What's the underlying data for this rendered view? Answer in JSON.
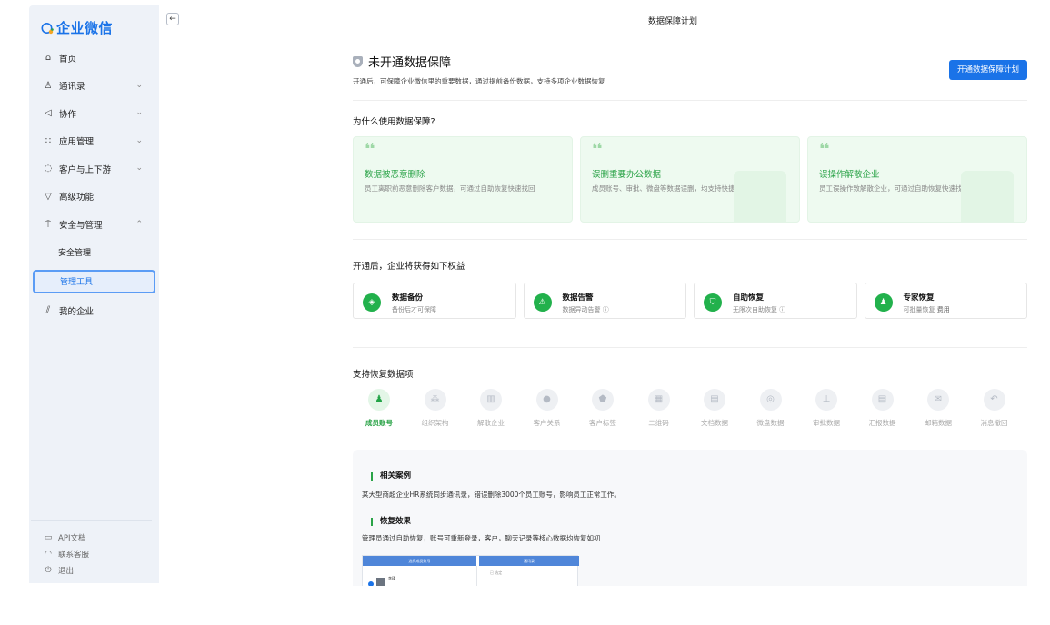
{
  "app": {
    "logo_text": "企业微信",
    "page_title": "数据保障计划",
    "back_icon": "←"
  },
  "sidebar": {
    "items": [
      {
        "label": "首页",
        "icon": "home-icon",
        "glyph": "⌂",
        "chevron": ""
      },
      {
        "label": "通讯录",
        "icon": "contacts-icon",
        "glyph": "♙",
        "chevron": "⌄"
      },
      {
        "label": "协作",
        "icon": "collab-icon",
        "glyph": "◁",
        "chevron": "⌄"
      },
      {
        "label": "应用管理",
        "icon": "apps-icon",
        "glyph": "∷",
        "chevron": "⌄"
      },
      {
        "label": "客户与上下游",
        "icon": "customer-icon",
        "glyph": "◌",
        "chevron": "⌄"
      },
      {
        "label": "高级功能",
        "icon": "advanced-icon",
        "glyph": "▽",
        "chevron": ""
      },
      {
        "label": "安全与管理",
        "icon": "security-icon",
        "glyph": "⍑",
        "chevron": "⌃"
      }
    ],
    "sub_items": [
      {
        "label": "安全管理"
      },
      {
        "label": "管理工具"
      }
    ],
    "my_company": {
      "label": "我的企业",
      "glyph": "⫽"
    },
    "bottom": [
      {
        "label": "API文档",
        "glyph": "▭"
      },
      {
        "label": "联系客服",
        "glyph": "◠"
      },
      {
        "label": "退出",
        "glyph": "⏻"
      }
    ]
  },
  "status": {
    "title": "未开通数据保障",
    "desc": "开通后，可保障企业微信里的重要数据，通过提前备份数据，支持多项企业数据恢复",
    "open_button": "开通数据保障计划"
  },
  "why": {
    "title": "为什么使用数据保障?",
    "quote": "❛❛",
    "cards": [
      {
        "title": "数据被恶意删除",
        "desc": "员工离职前恶意删除客户数据，可通过自助恢复快速找回"
      },
      {
        "title": "误删重要办公数据",
        "desc": "成员账号、审批、微盘等数据误删，均支持快捷找回"
      },
      {
        "title": "误操作解散企业",
        "desc": "员工误操作致解散企业，可通过自助恢复快速找回企业"
      }
    ]
  },
  "benefits": {
    "title": "开通后，企业将获得如下权益",
    "items": [
      {
        "name": "数据备份",
        "desc": "备份后才可保障",
        "glyph": "◈",
        "extra": ""
      },
      {
        "name": "数据告警",
        "desc": "数据异动告警 ⓘ",
        "glyph": "⚠",
        "extra": ""
      },
      {
        "name": "自助恢复",
        "desc": "无限次自助恢复 ⓘ",
        "glyph": "⛉",
        "extra": ""
      },
      {
        "name": "专家恢复",
        "desc": "可批量恢复 ",
        "glyph": "♟",
        "extra": "费用"
      }
    ]
  },
  "recover": {
    "title": "支持恢复数据项",
    "items": [
      {
        "label": "成员账号",
        "glyph": "♟",
        "active": true
      },
      {
        "label": "组织架构",
        "glyph": "⁂",
        "active": false
      },
      {
        "label": "解散企业",
        "glyph": "▥",
        "active": false
      },
      {
        "label": "客户关系",
        "glyph": "●",
        "active": false
      },
      {
        "label": "客户标签",
        "glyph": "⬟",
        "active": false
      },
      {
        "label": "二维码",
        "glyph": "▦",
        "active": false
      },
      {
        "label": "文档数据",
        "glyph": "▤",
        "active": false
      },
      {
        "label": "微盘数据",
        "glyph": "◎",
        "active": false
      },
      {
        "label": "审批数据",
        "glyph": "⊥",
        "active": false
      },
      {
        "label": "汇报数据",
        "glyph": "▤",
        "active": false
      },
      {
        "label": "邮箱数据",
        "glyph": "✉",
        "active": false
      },
      {
        "label": "消息撤回",
        "glyph": "↶",
        "active": false
      }
    ]
  },
  "detail": {
    "case_title": "相关案例",
    "case_text": "某大型商超企业HR系统同步通讯录，错误删除3000个员工账号，影响员工正常工作。",
    "effect_title": "恢复效果",
    "effect_text": "管理员通过自助恢复，账号可重新登录，客户，聊天记录等核心数据均恢复如初",
    "mock_left": "选择成员账号",
    "mock_right": "通讯录",
    "mock_name": "李瑾",
    "mock_sub": "已 选定"
  },
  "colors": {
    "accent": "#1a73e8",
    "green": "#22b14c",
    "sidebar_bg": "#eef2f8"
  }
}
